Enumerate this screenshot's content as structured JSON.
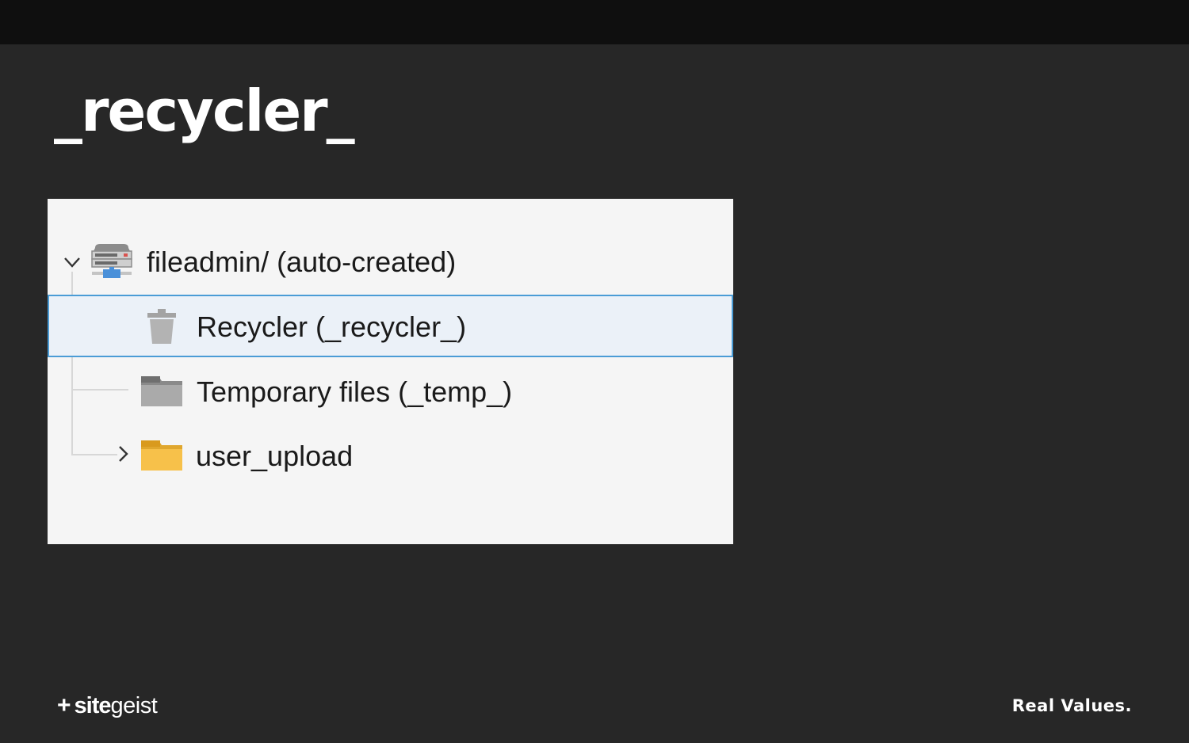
{
  "slide": {
    "title": "_recycler_"
  },
  "tree": {
    "root": {
      "label": "fileadmin/ (auto-created)",
      "icon": "storage-server-icon",
      "expanded": true
    },
    "children": [
      {
        "label": "Recycler (_recycler_)",
        "icon": "trash-icon",
        "selected": true
      },
      {
        "label": "Temporary files (_temp_)",
        "icon": "folder-gray-icon",
        "selected": false
      },
      {
        "label": "user_upload",
        "icon": "folder-yellow-icon",
        "collapsed": true,
        "selected": false
      }
    ]
  },
  "footer": {
    "brand_plus": "+",
    "brand_bold": "site",
    "brand_light": "geist",
    "tagline": "Real Values."
  },
  "colors": {
    "background": "#272727",
    "topbar": "#0f0f0f",
    "panel": "#f5f5f5",
    "selection_bg": "#ebf1f8",
    "selection_border": "#4a9cd6",
    "folder_yellow": "#f7c14a",
    "folder_gray": "#a8a8a8"
  }
}
